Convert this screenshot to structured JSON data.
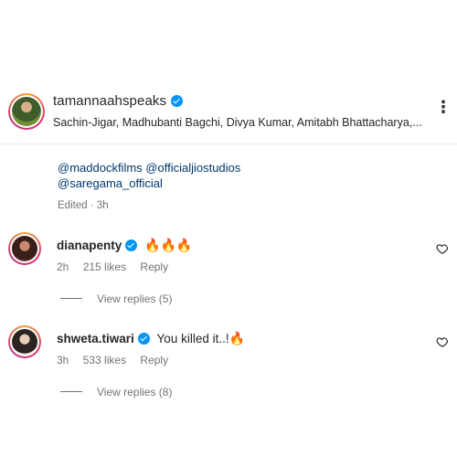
{
  "post": {
    "author": "tamannaahspeaks",
    "audio_credits": "Sachin-Jigar, Madhubanti Bagchi, Divya Kumar, Amitabh Bhattacharya,...",
    "caption_mentions": [
      "@maddockfilms @officialjiostudios",
      "@saregama_official"
    ],
    "edited_label": "Edited · 3h"
  },
  "comments": [
    {
      "username": "dianapenty",
      "text": "",
      "emoji": "🔥🔥🔥",
      "time": "2h",
      "likes": "215 likes",
      "reply_label": "Reply",
      "view_replies": "View replies (5)"
    },
    {
      "username": "shweta.tiwari",
      "text": "You killed it..!",
      "emoji": "🔥",
      "time": "3h",
      "likes": "533 likes",
      "reply_label": "Reply",
      "view_replies": "View replies (8)"
    }
  ],
  "icons": {
    "verified": "verified-badge-icon",
    "more": "more-options-icon",
    "heart": "heart-icon"
  },
  "colors": {
    "verified_blue": "#0095f6",
    "mention_blue": "#00376b",
    "secondary_text": "#737373",
    "fire": "#e8590c"
  }
}
